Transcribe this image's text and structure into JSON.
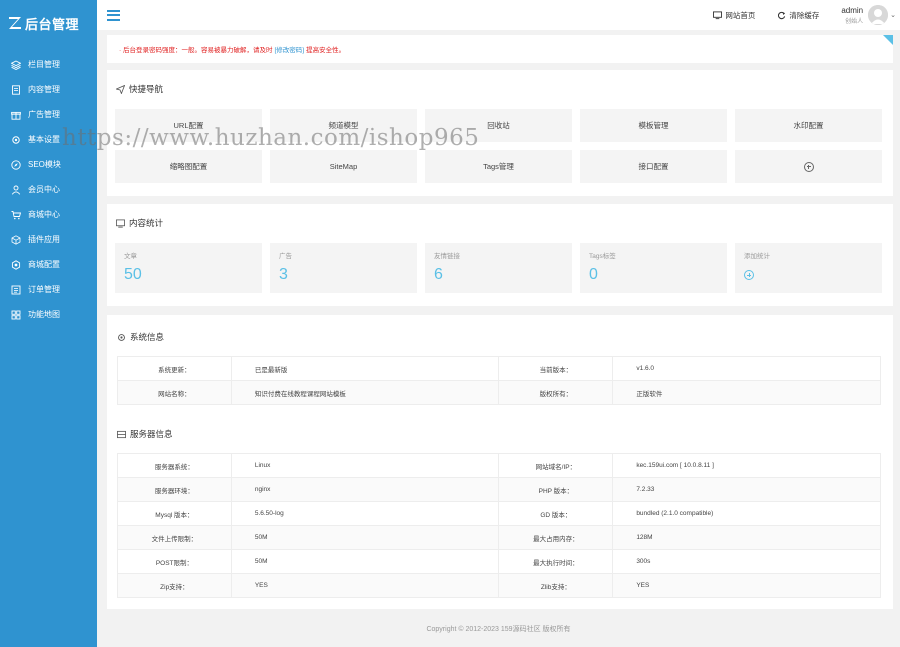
{
  "brand": {
    "title": "后台管理",
    "logo_icon": "z-logo-icon"
  },
  "sidebar": {
    "items": [
      {
        "label": "栏目管理",
        "icon": "layers-icon"
      },
      {
        "label": "内容管理",
        "icon": "document-icon"
      },
      {
        "label": "广告管理",
        "icon": "gift-icon"
      },
      {
        "label": "基本设置",
        "icon": "gear-icon"
      },
      {
        "label": "SEO模块",
        "icon": "compass-icon"
      },
      {
        "label": "会员中心",
        "icon": "user-icon"
      },
      {
        "label": "商城中心",
        "icon": "cart-icon"
      },
      {
        "label": "插件应用",
        "icon": "cube-icon"
      },
      {
        "label": "商城配置",
        "icon": "settings-icon"
      },
      {
        "label": "订单管理",
        "icon": "list-icon"
      },
      {
        "label": "功能地图",
        "icon": "grid-icon"
      }
    ]
  },
  "topbar": {
    "site_home": "网站首页",
    "clear_cache": "清除缓存",
    "user_name": "admin",
    "user_role": "创始人"
  },
  "notice": {
    "prefix": "· 后台登录密码强度：一般。容易被暴力破解，请及时",
    "link": "[修改密码]",
    "suffix": "提高安全性。"
  },
  "quick_nav": {
    "title": "快捷导航",
    "items": [
      "URL配置",
      "频道模型",
      "回收站",
      "模板管理",
      "水印配置",
      "缩略图配置",
      "SiteMap",
      "Tags管理",
      "接口配置"
    ]
  },
  "stats": {
    "title": "内容统计",
    "items": [
      {
        "label": "文章",
        "value": "50"
      },
      {
        "label": "广告",
        "value": "3"
      },
      {
        "label": "友情链接",
        "value": "6"
      },
      {
        "label": "Tags标签",
        "value": "0"
      }
    ],
    "add_label": "添加统计"
  },
  "system_info": {
    "title": "系统信息",
    "rows": [
      [
        "系统更新：",
        "已是最新版",
        "当前版本：",
        "v1.6.0"
      ],
      [
        "网站名称：",
        "知识付费在线教程课程网站模板",
        "版权所有：",
        "正版软件"
      ]
    ]
  },
  "server_info": {
    "title": "服务器信息",
    "rows": [
      [
        "服务器系统：",
        "Linux",
        "网站域名/IP：",
        "kec.159ui.com [ 10.0.8.11 ]"
      ],
      [
        "服务器环境：",
        "nginx",
        "PHP 版本：",
        "7.2.33"
      ],
      [
        "Mysql 版本：",
        "5.6.50-log",
        "GD 版本：",
        "bundled (2.1.0 compatible)"
      ],
      [
        "文件上传限制：",
        "50M",
        "最大占用内存：",
        "128M"
      ],
      [
        "POST限制：",
        "50M",
        "最大执行时间：",
        "300s"
      ],
      [
        "Zip支持：",
        "YES",
        "Zlib支持：",
        "YES"
      ]
    ]
  },
  "footer": "Copyright © 2012-2023 159源码社区 版权所有",
  "watermark": "https://www.huzhan.com/ishop965",
  "colors": {
    "sidebar": "#2f93d0",
    "accent": "#5bc0e6",
    "warning": "#e02020"
  }
}
